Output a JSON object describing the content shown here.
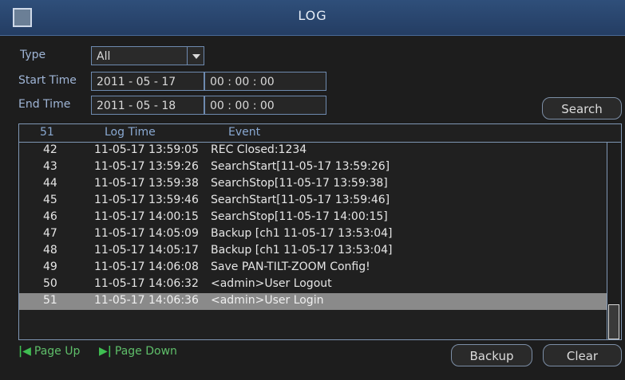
{
  "title": "LOG",
  "filters": {
    "type_label": "Type",
    "type_value": "All",
    "start_label": "Start Time",
    "start_date": "2011 - 05 - 17",
    "start_time": "00 : 00 : 00",
    "end_label": "End Time",
    "end_date": "2011 - 05 - 18",
    "end_time": "00 : 00 : 00",
    "search_label": "Search"
  },
  "table": {
    "headers": {
      "count": "51",
      "time": "Log Time",
      "event": "Event"
    },
    "rows": [
      {
        "num": "42",
        "time": "11-05-17 13:59:05",
        "event": "REC Closed:1234"
      },
      {
        "num": "43",
        "time": "11-05-17 13:59:26",
        "event": "SearchStart[11-05-17 13:59:26]"
      },
      {
        "num": "44",
        "time": "11-05-17 13:59:38",
        "event": "SearchStop[11-05-17 13:59:38]"
      },
      {
        "num": "45",
        "time": "11-05-17 13:59:46",
        "event": "SearchStart[11-05-17 13:59:46]"
      },
      {
        "num": "46",
        "time": "11-05-17 14:00:15",
        "event": "SearchStop[11-05-17 14:00:15]"
      },
      {
        "num": "47",
        "time": "11-05-17 14:05:09",
        "event": "Backup [ch1 11-05-17 13:53:04]"
      },
      {
        "num": "48",
        "time": "11-05-17 14:05:17",
        "event": "Backup [ch1 11-05-17 13:53:04]"
      },
      {
        "num": "49",
        "time": "11-05-17 14:06:08",
        "event": "Save PAN-TILT-ZOOM Config!"
      },
      {
        "num": "50",
        "time": "11-05-17 14:06:32",
        "event": "<admin>User Logout"
      },
      {
        "num": "51",
        "time": "11-05-17 14:06:36",
        "event": "<admin>User Login"
      }
    ],
    "selected_index": 9
  },
  "footer": {
    "page_up": "Page Up",
    "page_down": "Page Down",
    "backup": "Backup",
    "clear": "Clear"
  },
  "icons": {
    "page_up": "page-up-icon",
    "page_down": "page-down-icon",
    "dropdown": "chevron-down-icon",
    "app": "app-icon"
  },
  "colors": {
    "title_bar": "#2f4f7a",
    "label": "#9fb5d6",
    "selected_row": "#8a8a8a",
    "pager": "#3fbf52"
  }
}
